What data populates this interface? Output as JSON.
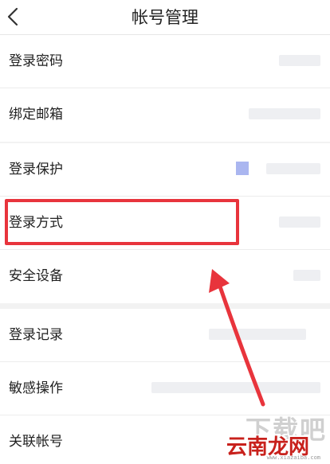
{
  "header": {
    "title": "帐号管理",
    "back_icon": "chevron-left-icon"
  },
  "groups": [
    {
      "rows": [
        {
          "label": "登录密码"
        },
        {
          "label": "绑定邮箱"
        }
      ]
    },
    {
      "rows": [
        {
          "label": "登录保护"
        },
        {
          "label": "登录方式"
        },
        {
          "label": "安全设备"
        }
      ]
    },
    {
      "rows": [
        {
          "label": "登录记录"
        },
        {
          "label": "敏感操作"
        },
        {
          "label": "关联帐号"
        }
      ]
    }
  ],
  "annotation": {
    "highlight_color": "#e8343c",
    "arrow_color": "#e8343c",
    "highlighted_row": "登录方式"
  },
  "watermark": {
    "brand": "云南龙网",
    "faint": "下载吧",
    "url": "www.xiazaiba.com"
  }
}
